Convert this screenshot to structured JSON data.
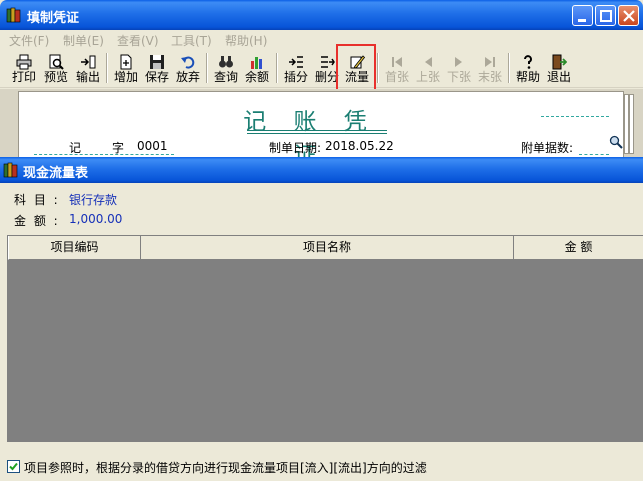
{
  "window": {
    "title": "填制凭证",
    "menus": [
      "文件(F)",
      "制单(E)",
      "查看(V)",
      "工具(T)",
      "帮助(H)"
    ]
  },
  "toolbar": {
    "print": "打印",
    "preview": "预览",
    "export": "输出",
    "add": "增加",
    "save": "保存",
    "discard": "放弃",
    "query": "查询",
    "balance": "余额",
    "insert_split": "插分",
    "delete_split": "删分",
    "cash_flow": "流量",
    "first": "首张",
    "prev": "上张",
    "next": "下张",
    "last": "末张",
    "help": "帮助",
    "exit": "退出"
  },
  "voucher": {
    "title": "记 账 凭 证",
    "type": "记",
    "char_label": "字",
    "number": "0001",
    "date_label": "制单日期:",
    "date": "2018.05.22",
    "attachments_label": "附单据数:"
  },
  "dialog": {
    "title": "现金流量表",
    "subject_label": "科 目 :",
    "subject_value": "银行存款",
    "amount_label": "金 额 :",
    "amount_value": "1,000.00",
    "columns": [
      "项目编码",
      "项目名称",
      "金  额"
    ],
    "filter_checked": true,
    "filter_label": "项目参照时，根据分录的借贷方向进行现金流量项目[流入][流出]方向的过滤"
  },
  "colors": {
    "titlebar": "#0754D8",
    "voucher_title": "#1A7E72",
    "value_text": "#1630B8",
    "highlight": "#E8302C",
    "grid_empty": "#808080"
  }
}
